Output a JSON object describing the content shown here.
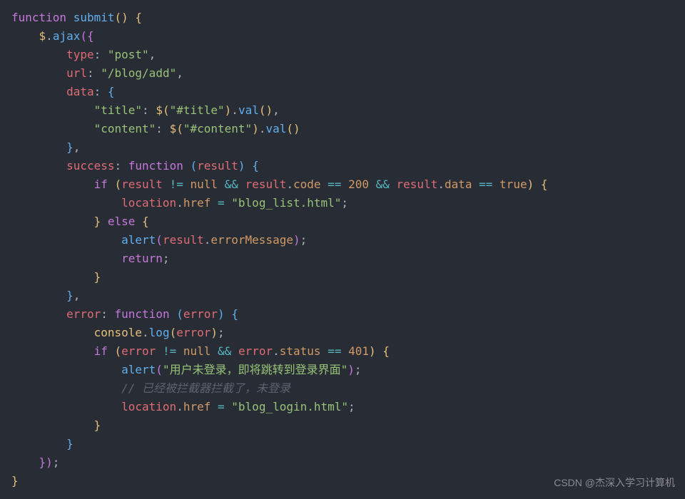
{
  "code": {
    "fn_kw": "function",
    "fn_name": "submit",
    "dollar": "$",
    "ajax": "ajax",
    "type_key": "type",
    "type_val": "\"post\"",
    "url_key": "url",
    "url_val": "\"/blog/add\"",
    "data_key": "data",
    "title_key": "\"title\"",
    "title_sel": "\"#title\"",
    "content_key": "\"content\"",
    "content_sel": "\"#content\"",
    "val_fn": "val",
    "success_key": "success",
    "fn_kw2": "function",
    "result_param": "result",
    "if_kw": "if",
    "null_kw": "null",
    "code_prop": "code",
    "code_200": "200",
    "data_prop": "data",
    "true_kw": "true",
    "location": "location",
    "href_prop": "href",
    "blog_list": "\"blog_list.html\"",
    "else_kw": "else",
    "alert_fn": "alert",
    "errmsg_prop": "errorMessage",
    "return_kw": "return",
    "error_key": "error",
    "error_param": "error",
    "console": "console",
    "log_fn": "log",
    "status_prop": "status",
    "code_401": "401",
    "alert_msg": "\"用户未登录，即将跳转到登录界面\"",
    "comment": "// 已经被拦截器拦截了，未登录",
    "blog_login": "\"blog_login.html\""
  },
  "watermark": "CSDN @杰深入学习计算机"
}
